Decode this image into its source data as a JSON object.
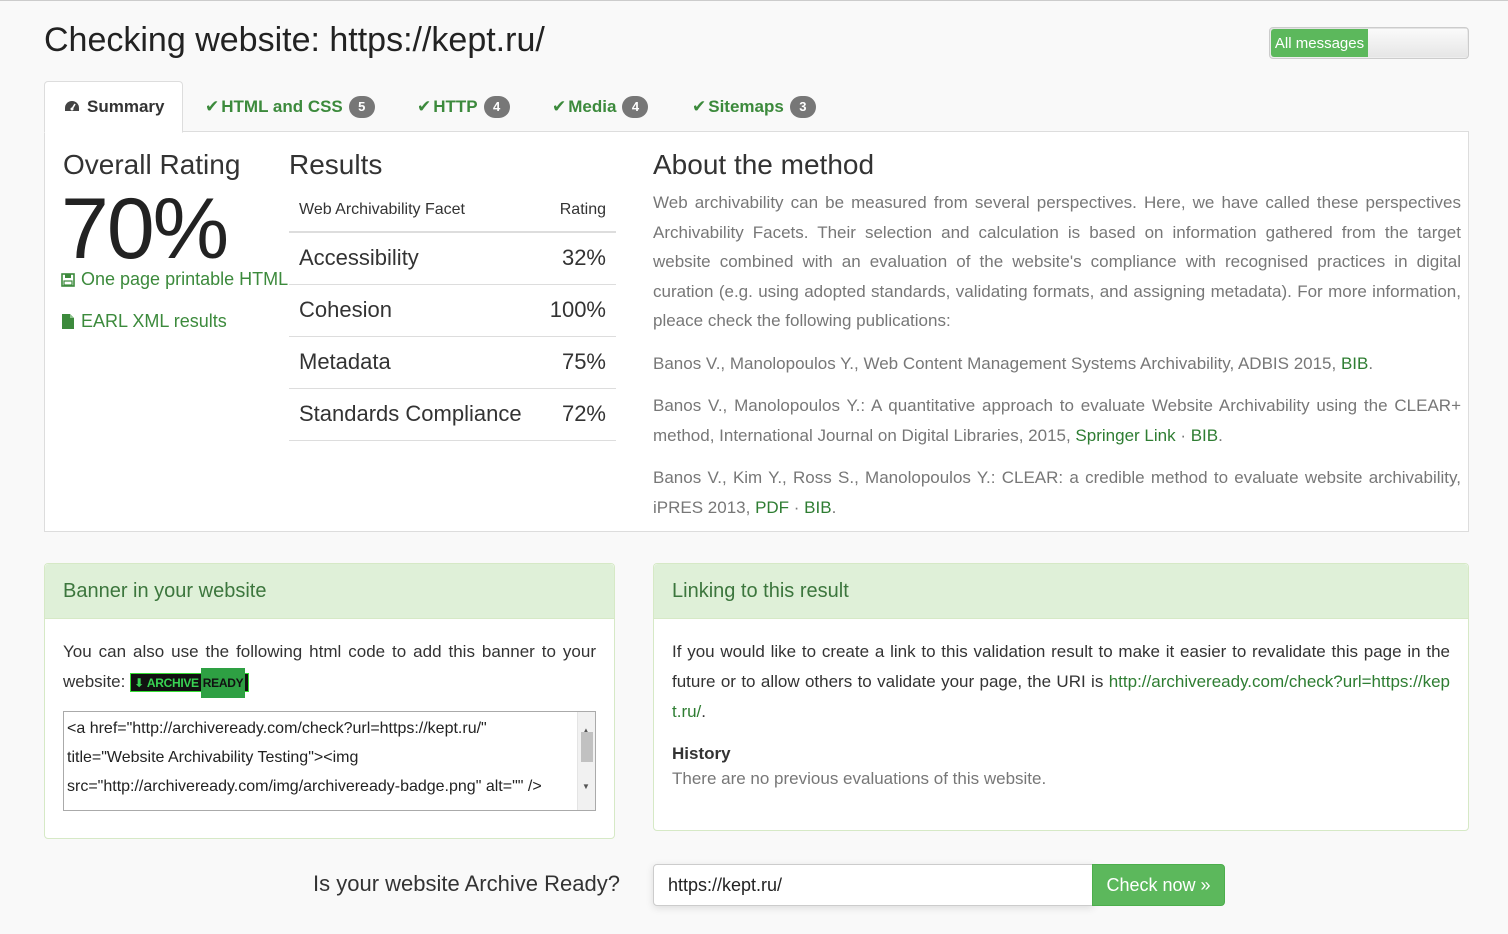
{
  "header": {
    "title": "Checking website: https://kept.ru/",
    "toggle_on_label": "All messages"
  },
  "tabs": [
    {
      "label": "Summary",
      "icon": "dashboard-icon",
      "active": true
    },
    {
      "label": "HTML and CSS",
      "badge": "5",
      "icon": "check-icon"
    },
    {
      "label": "HTTP",
      "badge": "4",
      "icon": "check-icon"
    },
    {
      "label": "Media",
      "badge": "4",
      "icon": "check-icon"
    },
    {
      "label": "Sitemaps",
      "badge": "3",
      "icon": "check-icon"
    }
  ],
  "overall": {
    "heading": "Overall Rating",
    "value": "70%",
    "printable_link": "One page printable HTML",
    "earl_link": "EARL XML results"
  },
  "results": {
    "heading": "Results",
    "col_facet": "Web Archivability Facet",
    "col_rating": "Rating",
    "rows": [
      {
        "facet": "Accessibility",
        "rating": "32%"
      },
      {
        "facet": "Cohesion",
        "rating": "100%"
      },
      {
        "facet": "Metadata",
        "rating": "75%"
      },
      {
        "facet": "Standards Compliance",
        "rating": "72%"
      }
    ]
  },
  "about": {
    "heading": "About the method",
    "intro": "Web archivability can be measured from several perspectives. Here, we have called these perspectives Archivability Facets. Their selection and calculation is based on information gathered from the target website combined with an evaluation of the website's compliance with recognised practices in digital curation (e.g. using adopted standards, validating formats, and assigning metadata). For more information, pleace check the following publications:",
    "pub1_text": "Banos V., Manolopoulos Y., Web Content Management Systems Archivability, ADBIS 2015, ",
    "pub1_bib": "BIB",
    "pub2_text": "Banos V., Manolopoulos Y.: A quantitative approach to evaluate Website Archivability using the CLEAR+ method, International Journal on Digital Libraries, 2015, ",
    "pub2_springer": "Springer Link",
    "pub2_bib": "BIB",
    "pub3_text": "Banos V., Kim Y., Ross S., Manolopoulos Y.: CLEAR: a credible method to evaluate website archivability, iPRES 2013, ",
    "pub3_pdf": "PDF",
    "pub3_bib": "BIB",
    "sep": " · ",
    "dot": "."
  },
  "banner": {
    "heading": "Banner in your website",
    "text": "You can also use the following html code to add this banner to your website: ",
    "badge_left": "ARCHIVE",
    "badge_right": "READY",
    "code": "<a href=\"http://archiveready.com/check?url=https://kept.ru/\" title=\"Website Archivability Testing\"><img src=\"http://archiveready.com/img/archiveready-badge.png\" alt=\"\" />"
  },
  "linking": {
    "heading": "Linking to this result",
    "text": "If you would like to create a link to this validation result to make it easier to revalidate this page in the future or to allow others to validate your page, the URI is ",
    "uri": "http://archiveready.com/check?url=https://kept.ru/",
    "dot": ".",
    "history_heading": "History",
    "history_text": "There are no previous evaluations of this website."
  },
  "form": {
    "label": "Is your website Archive Ready?",
    "input_value": "https://kept.ru/",
    "button_label": "Check now »"
  },
  "colors": {
    "accent": "#5cb85c",
    "link": "#3c8a3c",
    "panel_head_bg": "#dff0d8"
  }
}
